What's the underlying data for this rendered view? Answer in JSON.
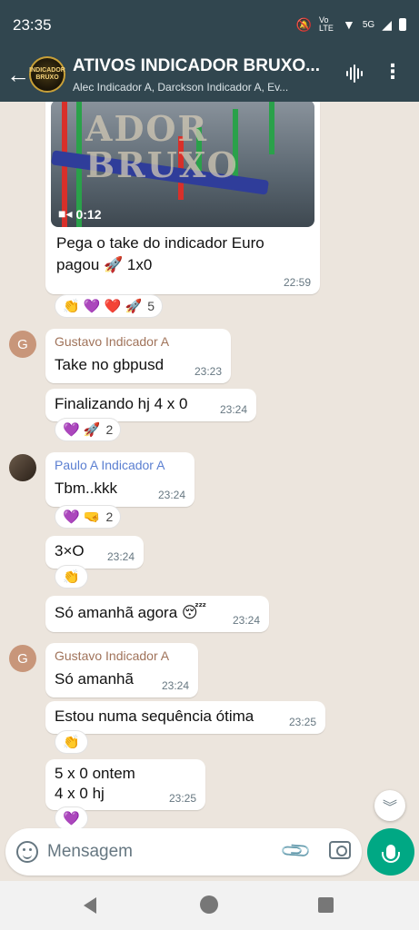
{
  "status_bar": {
    "time": "23:35",
    "icons": [
      "mute-icon",
      "volte-icon",
      "wifi-icon",
      "5g-icon",
      "signal-icon",
      "battery-icon"
    ],
    "network_label": "5G",
    "volte_label": "Vo LTE"
  },
  "header": {
    "title": "ATIVOS INDICADOR BRUXO...",
    "subtitle": "Alec Indicador A, Darckson Indicador A, Ev...",
    "avatar_text": "INDICADOR BRUXO",
    "accent_color": "#31464f"
  },
  "messages": [
    {
      "video": {
        "duration": "0:12",
        "watermark": "ADOR\nBRUXO"
      },
      "text": "Pega o take do indicador Euro pagou 🚀 1x0",
      "time": "22:59",
      "reactions": "👏 💜 ❤️ 🚀",
      "reaction_count": "5"
    },
    {
      "sender": "Gustavo Indicador A",
      "sender_color": "#a0735a",
      "avatar_letter": "G",
      "text": "Take no gbpusd",
      "time": "23:23"
    },
    {
      "text": "Finalizando hj 4 x 0",
      "time": "23:24",
      "reactions": "💜 🚀",
      "reaction_count": "2"
    },
    {
      "sender": "Paulo A Indicador A",
      "sender_color": "#5b7fd1",
      "text": "Tbm..kkk",
      "time": "23:24",
      "reactions": "💜 🤜",
      "reaction_count": "2"
    },
    {
      "text": "3×O",
      "time": "23:24",
      "reactions": "👏"
    },
    {
      "text": "Só amanhã agora 😴",
      "time": "23:24"
    },
    {
      "sender": "Gustavo Indicador A",
      "sender_color": "#a0735a",
      "avatar_letter": "G",
      "text": "Só amanhã",
      "time": "23:24"
    },
    {
      "text": "Estou numa sequência ótima",
      "time": "23:25",
      "reactions": "👏"
    },
    {
      "text_line1": "5 x 0 ontem",
      "text_line2": "4 x 0 hj",
      "time": "23:25",
      "reactions": "💜"
    }
  ],
  "composer": {
    "placeholder": "Mensagem"
  }
}
